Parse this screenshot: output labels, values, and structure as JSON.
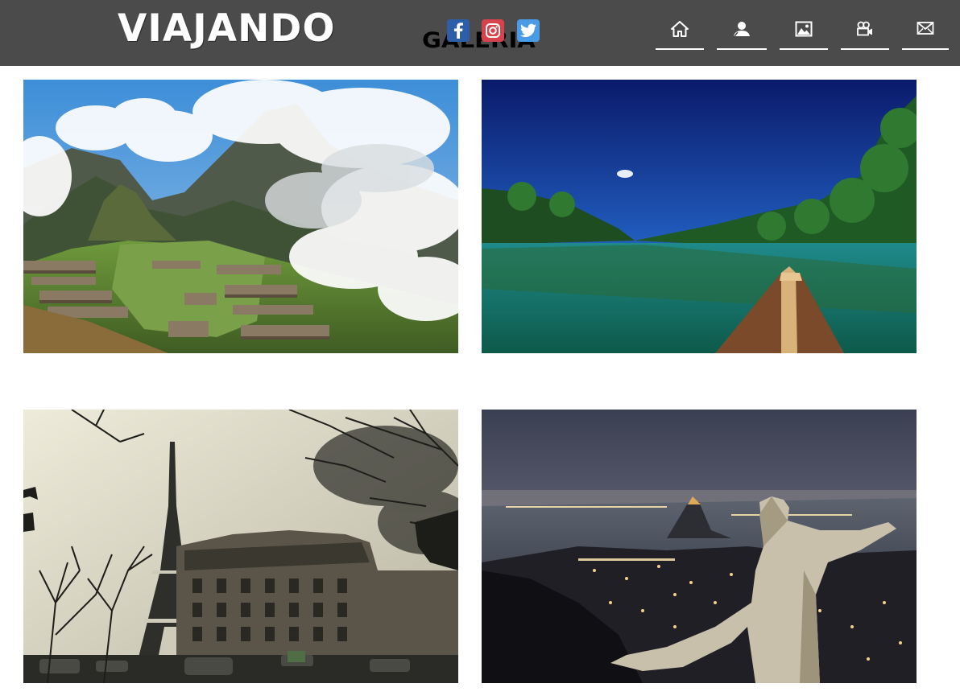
{
  "header": {
    "logo_text": "VIAJANDO",
    "page_title": "GALERIA",
    "background_color": "#4b4b4b"
  },
  "social": [
    {
      "name": "facebook",
      "icon": "facebook-icon",
      "color": "#2d5fa8"
    },
    {
      "name": "instagram",
      "icon": "instagram-icon",
      "color": "#d7434c"
    },
    {
      "name": "twitter",
      "icon": "twitter-icon",
      "color": "#4a9be6"
    }
  ],
  "nav": [
    {
      "icon": "home-icon"
    },
    {
      "icon": "user-icon"
    },
    {
      "icon": "image-icon"
    },
    {
      "icon": "video-camera-icon"
    },
    {
      "icon": "envelope-icon"
    }
  ],
  "gallery": [
    {
      "scene": "mountain ruins in clouds"
    },
    {
      "scene": "river with canoe bow"
    },
    {
      "scene": "eiffel tower and parisian buildings"
    },
    {
      "scene": "city at night with statue"
    }
  ]
}
